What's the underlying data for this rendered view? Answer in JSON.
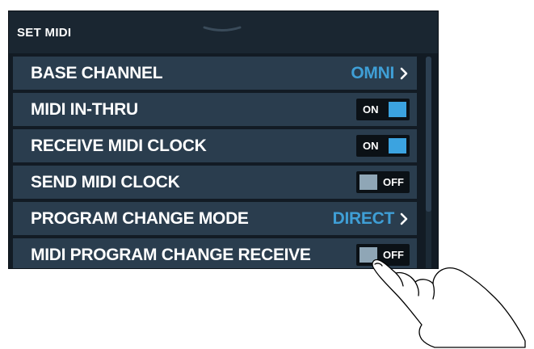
{
  "header": {
    "title": "SET MIDI",
    "handle_icon": "chevron-down-icon"
  },
  "rows": [
    {
      "label": "BASE CHANNEL",
      "type": "select",
      "value": "OMNI"
    },
    {
      "label": "MIDI IN-THRU",
      "type": "toggle",
      "state_text": "ON"
    },
    {
      "label": "RECEIVE MIDI CLOCK",
      "type": "toggle",
      "state_text": "ON"
    },
    {
      "label": "SEND MIDI CLOCK",
      "type": "toggle",
      "state_text": "OFF"
    },
    {
      "label": "PROGRAM CHANGE MODE",
      "type": "select",
      "value": "DIRECT"
    },
    {
      "label": "MIDI PROGRAM CHANGE RECEIVE",
      "type": "toggle",
      "state_text": "OFF"
    }
  ],
  "colors": {
    "background": "#121b24",
    "row": "#2a3d4e",
    "accent": "#3f9fd6",
    "toggle_on": "#3ba3e0",
    "toggle_off": "#8fa6b6"
  }
}
